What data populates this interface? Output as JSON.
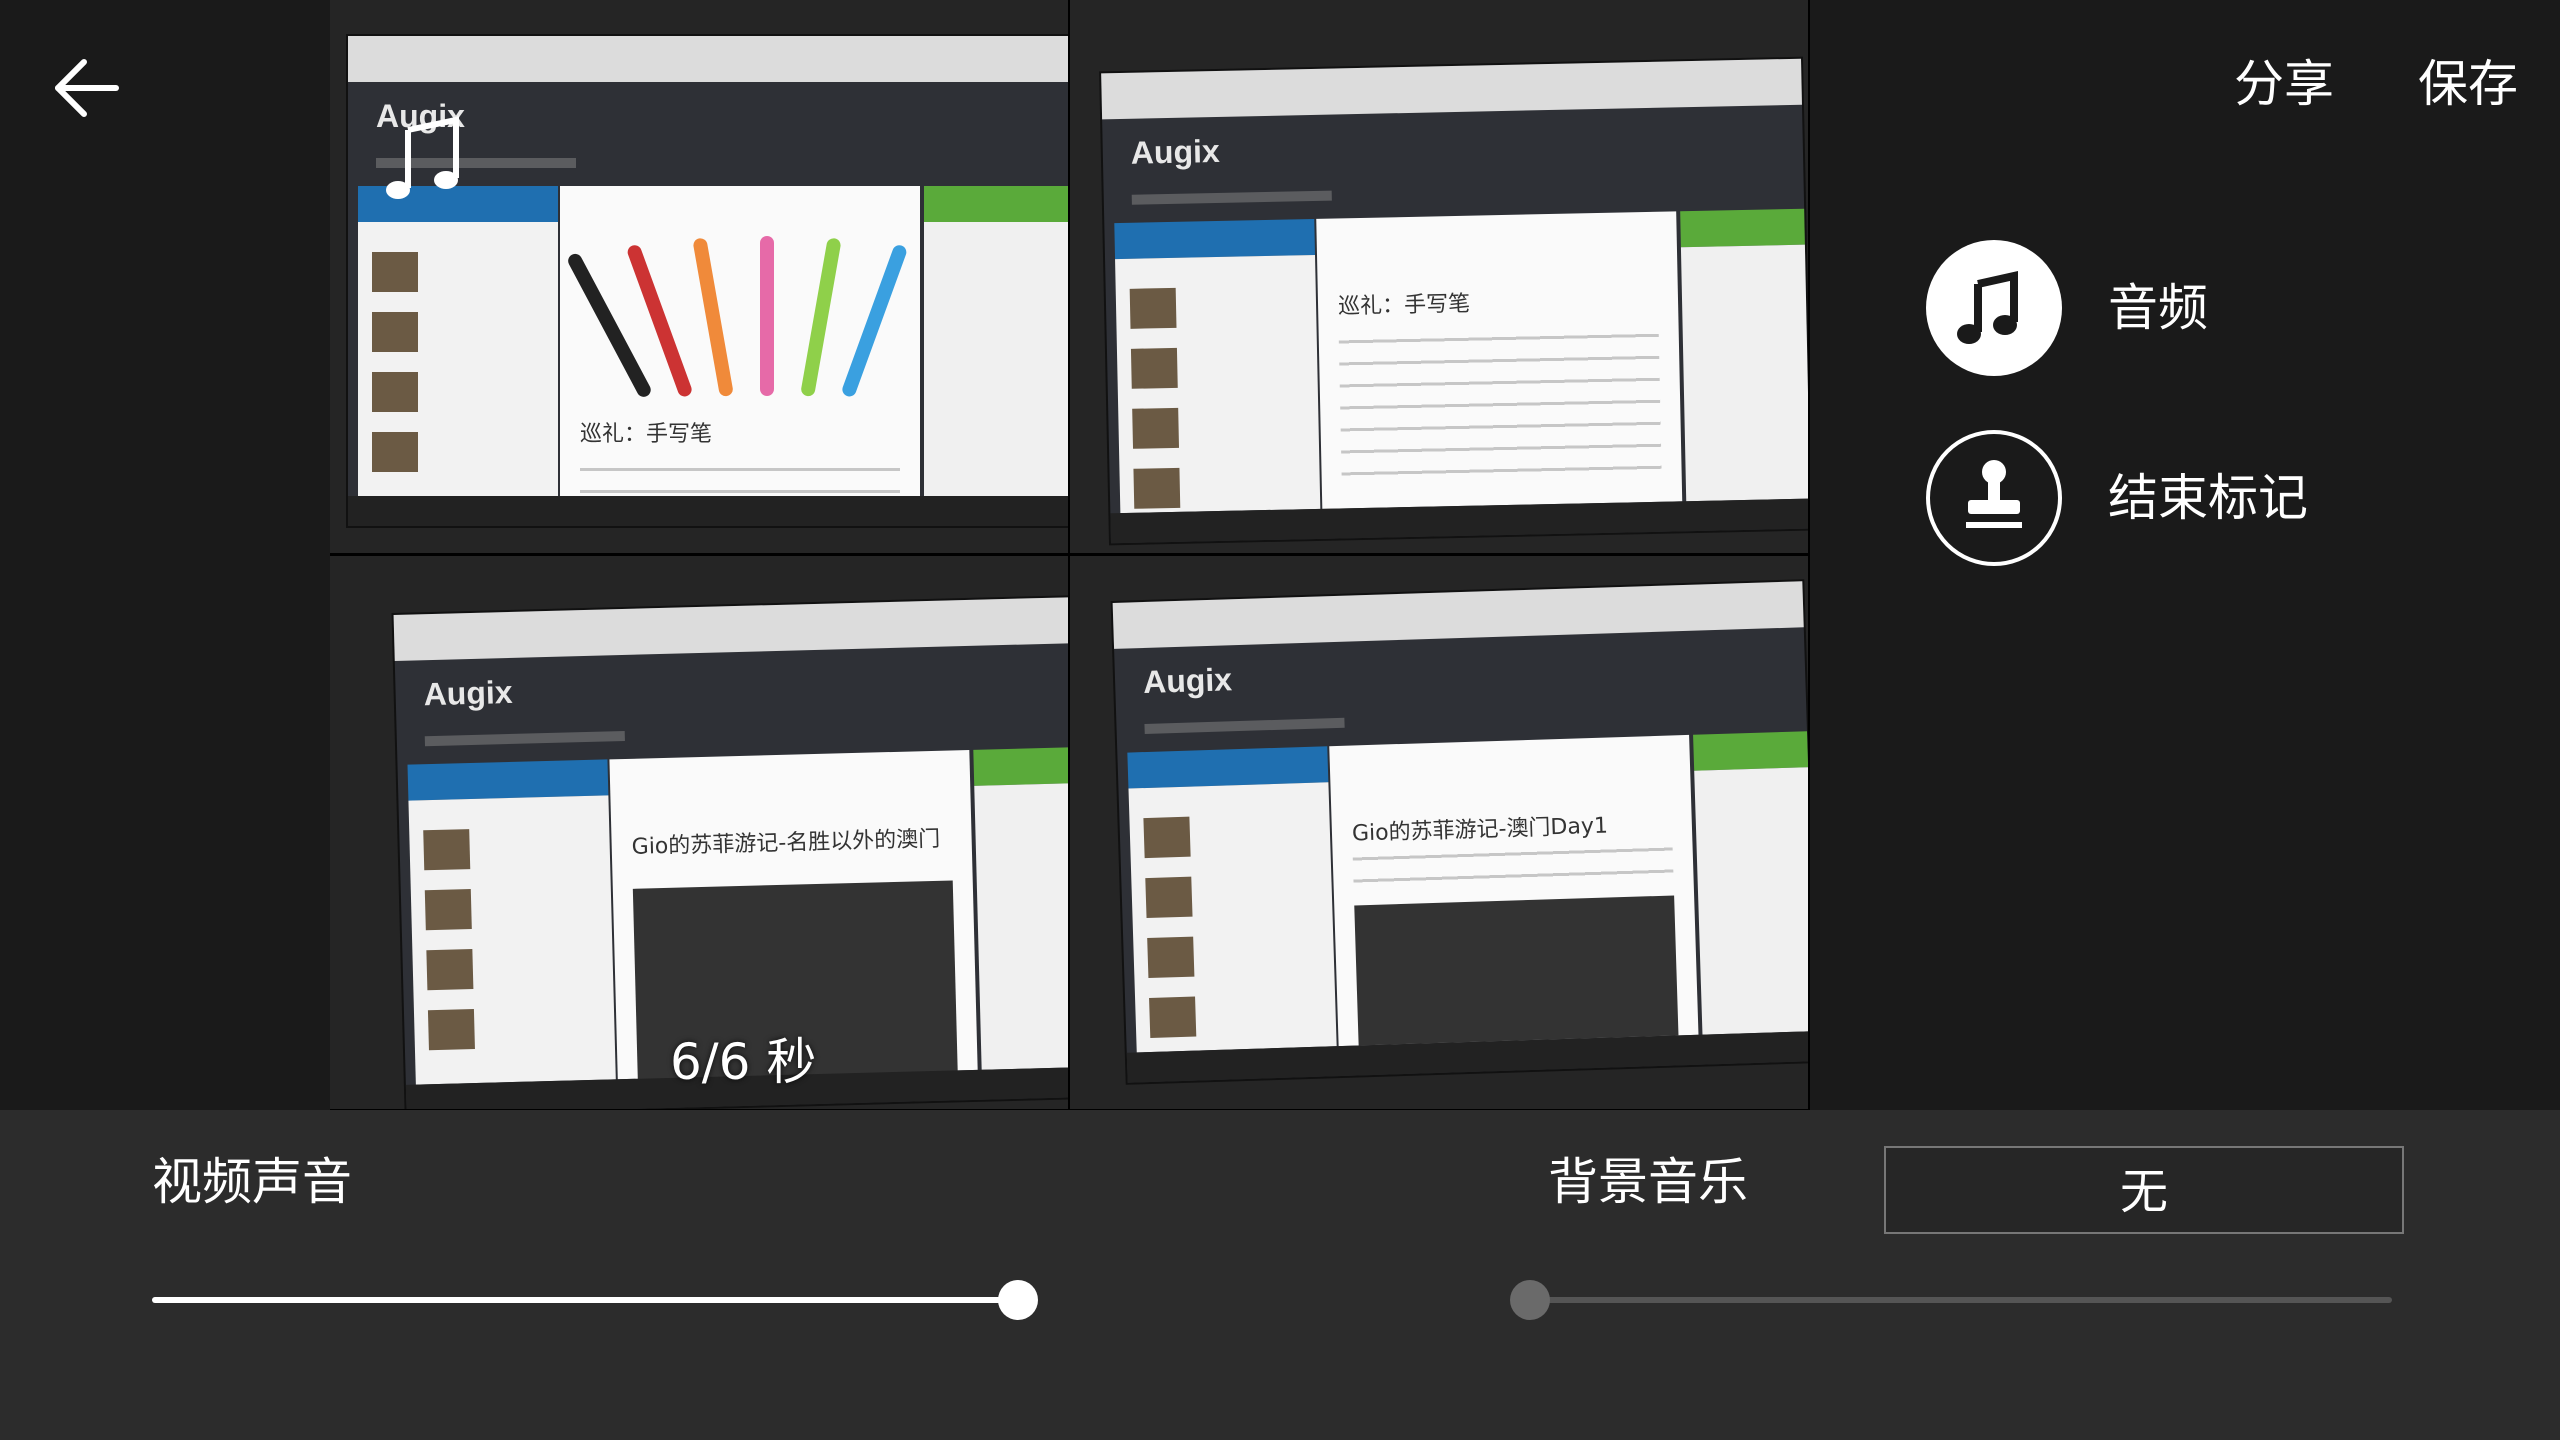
{
  "header": {
    "back_icon": "arrow-left-icon",
    "share_label": "分享",
    "save_label": "保存"
  },
  "preview": {
    "time_label": "6/6 秒",
    "frames": [
      {
        "brand": "Augix",
        "post_title": "巡礼：手写笔"
      },
      {
        "brand": "Augix",
        "post_title": "巡礼：手写笔"
      },
      {
        "brand": "Augix",
        "post_title": "Gio的苏菲游记-名胜以外的澳门"
      },
      {
        "brand": "Augix",
        "post_title": "Gio的苏菲游记-澳门Day1"
      }
    ],
    "overlay_icon": "music-note-icon"
  },
  "tools": {
    "audio": {
      "label": "音频",
      "icon": "music-note-icon"
    },
    "end_mark": {
      "label": "结束标记",
      "icon": "stamp-icon"
    }
  },
  "audio_panel": {
    "video_sound_label": "视频声音",
    "video_sound_level": 1.0,
    "bgm_label": "背景音乐",
    "bgm_selected": "无",
    "bgm_level": 0.0
  },
  "colors": {
    "background": "#1a1a1a",
    "panel": "#2c2c2c",
    "accent": "#ffffff",
    "blue_bar": "#1f6fb0",
    "green_bar": "#5aaa3a"
  }
}
